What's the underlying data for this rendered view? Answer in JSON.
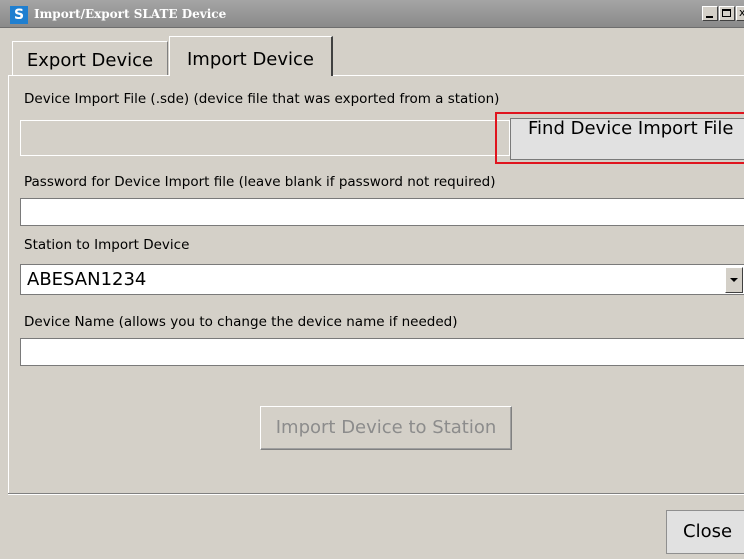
{
  "window": {
    "title": "Import/Export SLATE Device",
    "icon_letter": "S",
    "icon_color": "#1f7fd0"
  },
  "tabs": [
    {
      "label": "Export Device",
      "active": false
    },
    {
      "label": "Import Device",
      "active": true
    }
  ],
  "import": {
    "file_label": "Device Import File (.sde) (device file that was exported from a station)",
    "file_value": "",
    "find_button_label": "Find Device Import File",
    "password_label": "Password for Device Import file (leave blank if password not required)",
    "password_value": "",
    "station_label": "Station to Import Device",
    "station_selected": "ABESAN1234",
    "name_label": "Device Name (allows you to change the device name if needed)",
    "name_value": "",
    "import_button_label": "Import Device to Station",
    "import_button_enabled": false
  },
  "footer": {
    "close_label": "Close"
  },
  "colors": {
    "highlight": "#e0141e",
    "disabled_text": "#8c8c8c"
  }
}
